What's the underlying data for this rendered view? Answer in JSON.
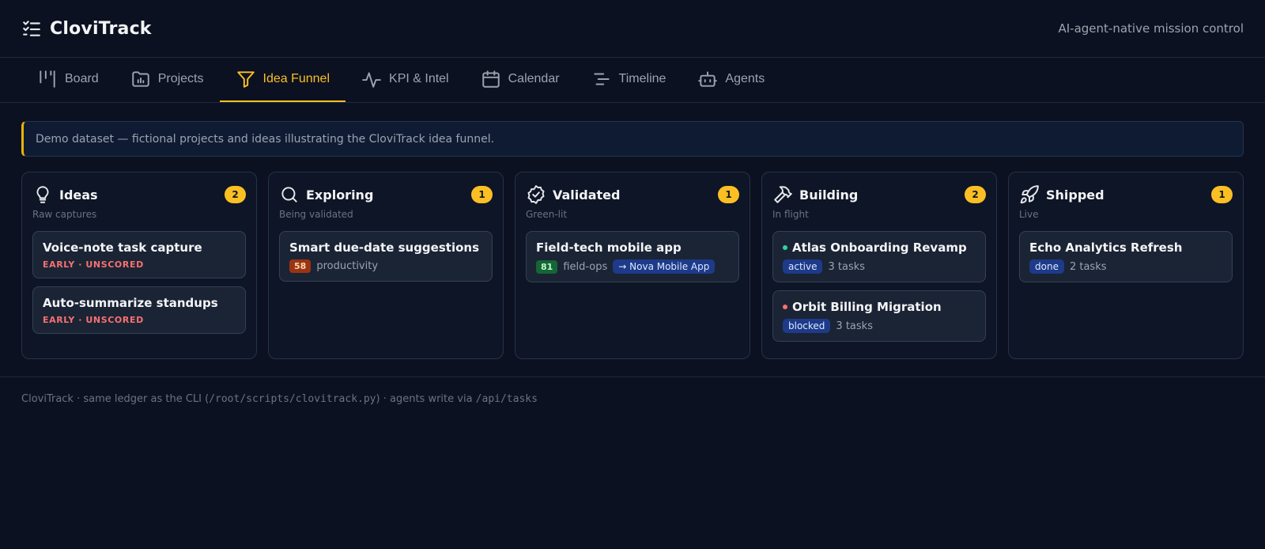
{
  "app": {
    "title": "CloviTrack",
    "tagline": "AI-agent-native mission control"
  },
  "nav": {
    "tabs": [
      {
        "label": "Board",
        "icon": "board-icon"
      },
      {
        "label": "Projects",
        "icon": "folder-chart-icon"
      },
      {
        "label": "Idea Funnel",
        "icon": "funnel-icon",
        "active": true
      },
      {
        "label": "KPI & Intel",
        "icon": "pulse-icon"
      },
      {
        "label": "Calendar",
        "icon": "calendar-icon"
      },
      {
        "label": "Timeline",
        "icon": "timeline-icon"
      },
      {
        "label": "Agents",
        "icon": "robot-icon"
      }
    ]
  },
  "banner": {
    "text": "Demo dataset — fictional projects and ideas illustrating the CloviTrack idea funnel."
  },
  "columns": [
    {
      "title": "Ideas",
      "count": "2",
      "subtitle": "Raw captures",
      "icon": "lightbulb-icon",
      "cards": [
        {
          "title": "Voice-note task capture",
          "status": "EARLY · UNSCORED"
        },
        {
          "title": "Auto-summarize standups",
          "status": "EARLY · UNSCORED"
        }
      ]
    },
    {
      "title": "Exploring",
      "count": "1",
      "subtitle": "Being validated",
      "icon": "search-icon",
      "cards": [
        {
          "title": "Smart due-date suggestions",
          "score": "58",
          "category": "productivity"
        }
      ]
    },
    {
      "title": "Validated",
      "count": "1",
      "subtitle": "Green-lit",
      "icon": "badge-check-icon",
      "cards": [
        {
          "title": "Field-tech mobile app",
          "score": "81",
          "category": "field-ops",
          "link": "→ Nova Mobile App"
        }
      ]
    },
    {
      "title": "Building",
      "count": "2",
      "subtitle": "In flight",
      "icon": "hammer-icon",
      "cards": [
        {
          "title": "Atlas Onboarding Revamp",
          "state": "active",
          "tasks": "3 tasks"
        },
        {
          "title": "Orbit Billing Migration",
          "state": "blocked",
          "tasks": "3 tasks"
        }
      ]
    },
    {
      "title": "Shipped",
      "count": "1",
      "subtitle": "Live",
      "icon": "rocket-icon",
      "cards": [
        {
          "title": "Echo Analytics Refresh",
          "state": "done",
          "tasks": "2 tasks"
        }
      ]
    }
  ],
  "footer": {
    "prefix": "CloviTrack · same ledger as the CLI (",
    "cli_path": "/root/scripts/clovitrack.py",
    "middle": ") · agents write via ",
    "api_path": "/api/tasks"
  },
  "colors": {
    "accent": "#fbbf24",
    "background": "#0b1120",
    "score_orange": "#9a3412",
    "score_green": "#166534",
    "dot_active": "#34d399",
    "dot_blocked": "#f87171",
    "early": "#f87171"
  }
}
